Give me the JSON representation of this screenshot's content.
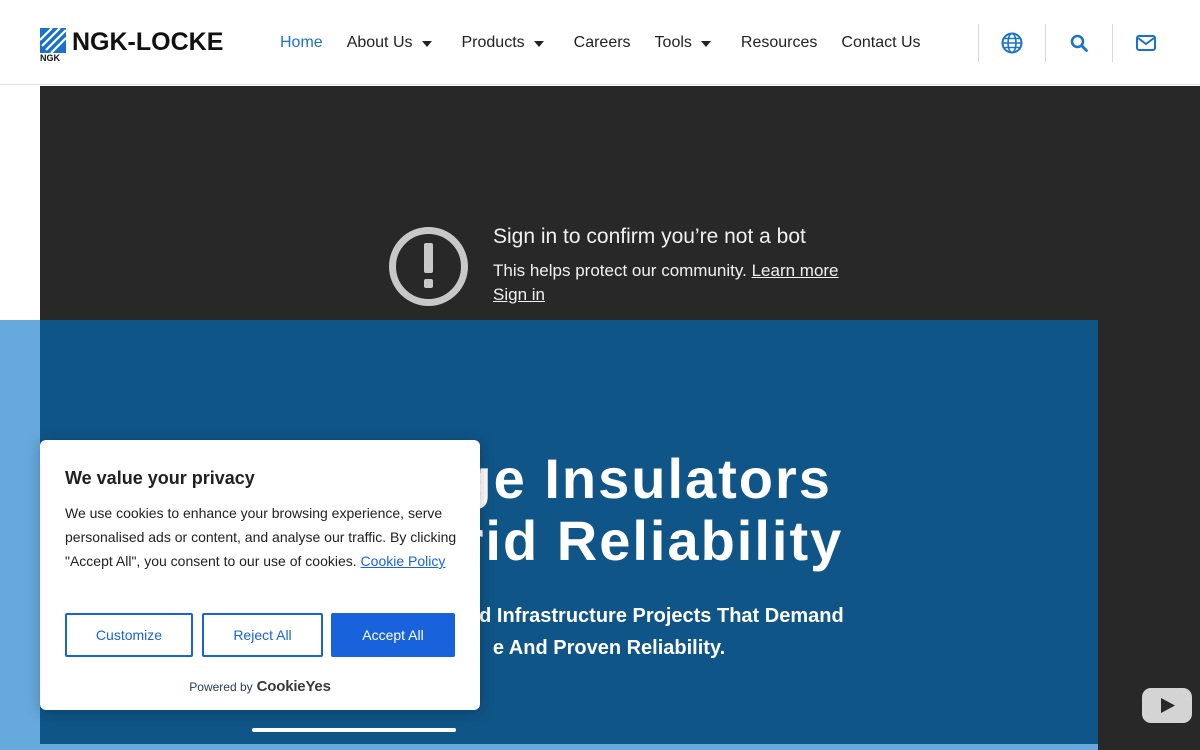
{
  "header": {
    "logo_text": "NGK-LOCKE",
    "logo_sub": "NGK",
    "nav": [
      {
        "label": "Home",
        "active": true,
        "dropdown": false
      },
      {
        "label": "About Us",
        "active": false,
        "dropdown": true
      },
      {
        "label": "Products",
        "active": false,
        "dropdown": true
      },
      {
        "label": "Careers",
        "active": false,
        "dropdown": false
      },
      {
        "label": "Tools",
        "active": false,
        "dropdown": true
      },
      {
        "label": "Resources",
        "active": false,
        "dropdown": false
      },
      {
        "label": "Contact Us",
        "active": false,
        "dropdown": false
      }
    ],
    "icons": [
      "globe-icon",
      "search-icon",
      "mail-icon"
    ]
  },
  "video": {
    "title": "Sign in to confirm you’re not a bot",
    "text": "This helps protect our community.",
    "learn_more": "Learn more",
    "sign_in": "Sign in"
  },
  "hero": {
    "title_line1": "ltage Insulators",
    "title_line2": "r Grid Reliability",
    "sub_line1": ", OEMs, And Infrastructure Projects That Demand",
    "sub_line2": "e And Proven Reliability."
  },
  "cookie": {
    "title": "We value your privacy",
    "text": "We use cookies to enhance your browsing experience, serve personalised ads or content, and analyse our traffic. By clicking \"Accept All\", you consent to our use of cookies.",
    "policy_link": "Cookie Policy",
    "customize": "Customize",
    "reject": "Reject All",
    "accept": "Accept All",
    "powered_by": "Powered by",
    "brand": "CookieYes"
  },
  "colors": {
    "accent": "#1b73c9",
    "hero_bg": "#0f5587",
    "hero_light": "#66a9dc",
    "video_bg": "#282828",
    "cookie_blue": "#1863dc"
  }
}
